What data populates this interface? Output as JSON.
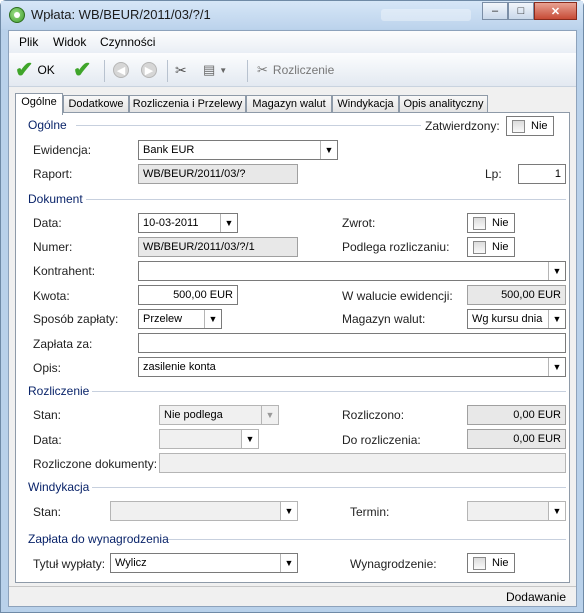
{
  "window": {
    "title": "Wpłata: WB/BEUR/2011/03/?/1",
    "minimize": "–",
    "maximize": "□",
    "close": "✕"
  },
  "menu": {
    "plik": "Plik",
    "widok": "Widok",
    "czynnosci": "Czynności"
  },
  "toolbar": {
    "ok": "OK",
    "rozliczenie": "Rozliczenie"
  },
  "tabs": [
    "Ogólne",
    "Dodatkowe",
    "Rozliczenia i Przelewy",
    "Magazyn walut",
    "Windykacja",
    "Opis analityczny"
  ],
  "ogolne": {
    "section": "Ogólne",
    "zatwierdzony_label": "Zatwierdzony:",
    "zatwierdzony_value": "Nie",
    "ewidencja_label": "Ewidencja:",
    "ewidencja_value": "Bank EUR",
    "raport_label": "Raport:",
    "raport_value": "WB/BEUR/2011/03/?",
    "lp_label": "Lp:",
    "lp_value": "1"
  },
  "dokument": {
    "section": "Dokument",
    "data_label": "Data:",
    "data_value": "10-03-2011",
    "zwrot_label": "Zwrot:",
    "zwrot_value": "Nie",
    "numer_label": "Numer:",
    "numer_value": "WB/BEUR/2011/03/?/1",
    "podlega_label": "Podlega rozliczaniu:",
    "podlega_value": "Nie",
    "kontrahent_label": "Kontrahent:",
    "kontrahent_value": "",
    "kwota_label": "Kwota:",
    "kwota_value": "500,00 EUR",
    "walucie_label": "W walucie ewidencji:",
    "walucie_value": "500,00 EUR",
    "sposob_label": "Sposób zapłaty:",
    "sposob_value": "Przelew",
    "magazyn_label": "Magazyn walut:",
    "magazyn_value": "Wg kursu dnia",
    "zaplata_label": "Zapłata za:",
    "zaplata_value": "",
    "opis_label": "Opis:",
    "opis_value": "zasilenie konta"
  },
  "rozliczenie": {
    "section": "Rozliczenie",
    "stan_label": "Stan:",
    "stan_value": "Nie podlega",
    "rozliczono_label": "Rozliczono:",
    "rozliczono_value": "0,00 EUR",
    "data_label": "Data:",
    "data_value": "",
    "do_label": "Do rozliczenia:",
    "do_value": "0,00 EUR",
    "dokumenty_label": "Rozliczone dokumenty:",
    "dokumenty_value": ""
  },
  "windykacja": {
    "section": "Windykacja",
    "stan_label": "Stan:",
    "stan_value": "",
    "termin_label": "Termin:",
    "termin_value": ""
  },
  "wynagrodzenie": {
    "section": "Zapłata do wynagrodzenia",
    "tytul_label": "Tytuł wypłaty:",
    "tytul_value": "Wylicz",
    "wyn_label": "Wynagrodzenie:",
    "wyn_value": "Nie"
  },
  "status": {
    "mode": "Dodawanie"
  },
  "colors": {
    "accent": "#0a246a",
    "ok_green": "#3fa52a",
    "close_red": "#c74b36"
  }
}
